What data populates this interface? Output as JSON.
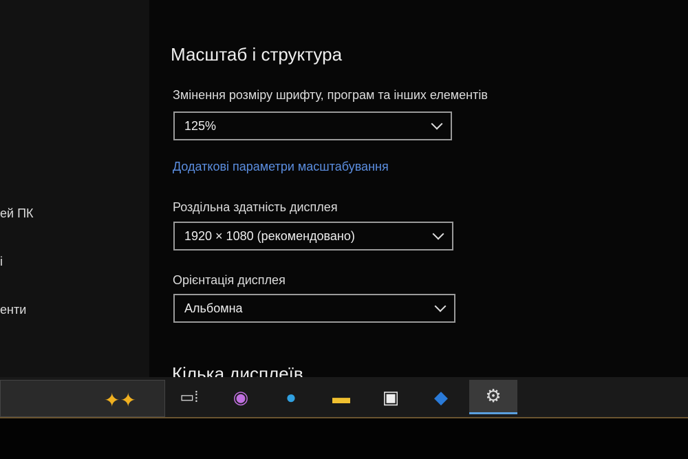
{
  "sidebar": {
    "items": [
      "ей ПК",
      "і",
      "енти"
    ]
  },
  "main": {
    "section_title": "Масштаб і структура",
    "scale": {
      "label": "Змінення розміру шрифту, програм та інших елементів",
      "value": "125%"
    },
    "advanced_link": "Додаткові параметри масштабування",
    "resolution": {
      "label": "Роздільна здатність дисплея",
      "value": "1920 × 1080 (рекомендовано)"
    },
    "orientation": {
      "label": "Орієнтація дисплея",
      "value": "Альбомна"
    },
    "next_section": "Кілька дисплеїв"
  },
  "taskbar": {
    "apps": [
      "task-view",
      "copilot",
      "edge",
      "file-explorer",
      "store",
      "outlook",
      "settings"
    ],
    "active": "settings"
  }
}
